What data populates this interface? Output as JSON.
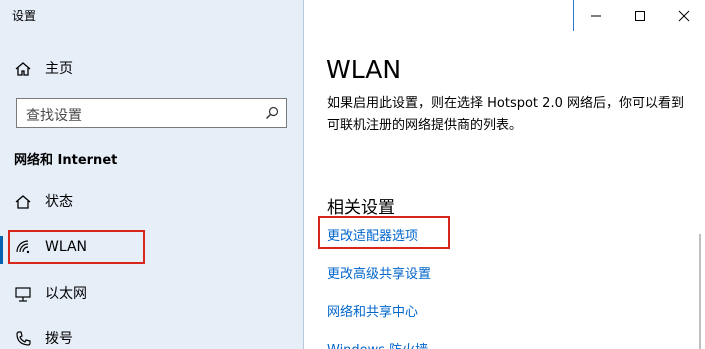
{
  "app": {
    "title": "设置"
  },
  "sidebar": {
    "home_label": "主页",
    "search_placeholder": "查找设置",
    "section_title": "网络和 Internet",
    "items": [
      {
        "label": "状态",
        "icon": "home-status-icon"
      },
      {
        "label": "WLAN",
        "icon": "wifi-icon",
        "selected": true
      },
      {
        "label": "以太网",
        "icon": "ethernet-icon"
      },
      {
        "label": "拨号",
        "icon": "dialup-icon"
      }
    ]
  },
  "main": {
    "title": "WLAN",
    "description": "如果启用此设置，则在选择 Hotspot 2.0 网络后，你可以看到可联机注册的网络提供商的列表。",
    "related_title": "相关设置",
    "links": [
      "更改适配器选项",
      "更改高级共享设置",
      "网络和共享中心",
      "Windows 防火墙"
    ]
  },
  "colors": {
    "accent": "#0063b1",
    "link": "#0066cc",
    "highlight": "#d9261c",
    "sidebar_bg": "#e6eef8"
  }
}
